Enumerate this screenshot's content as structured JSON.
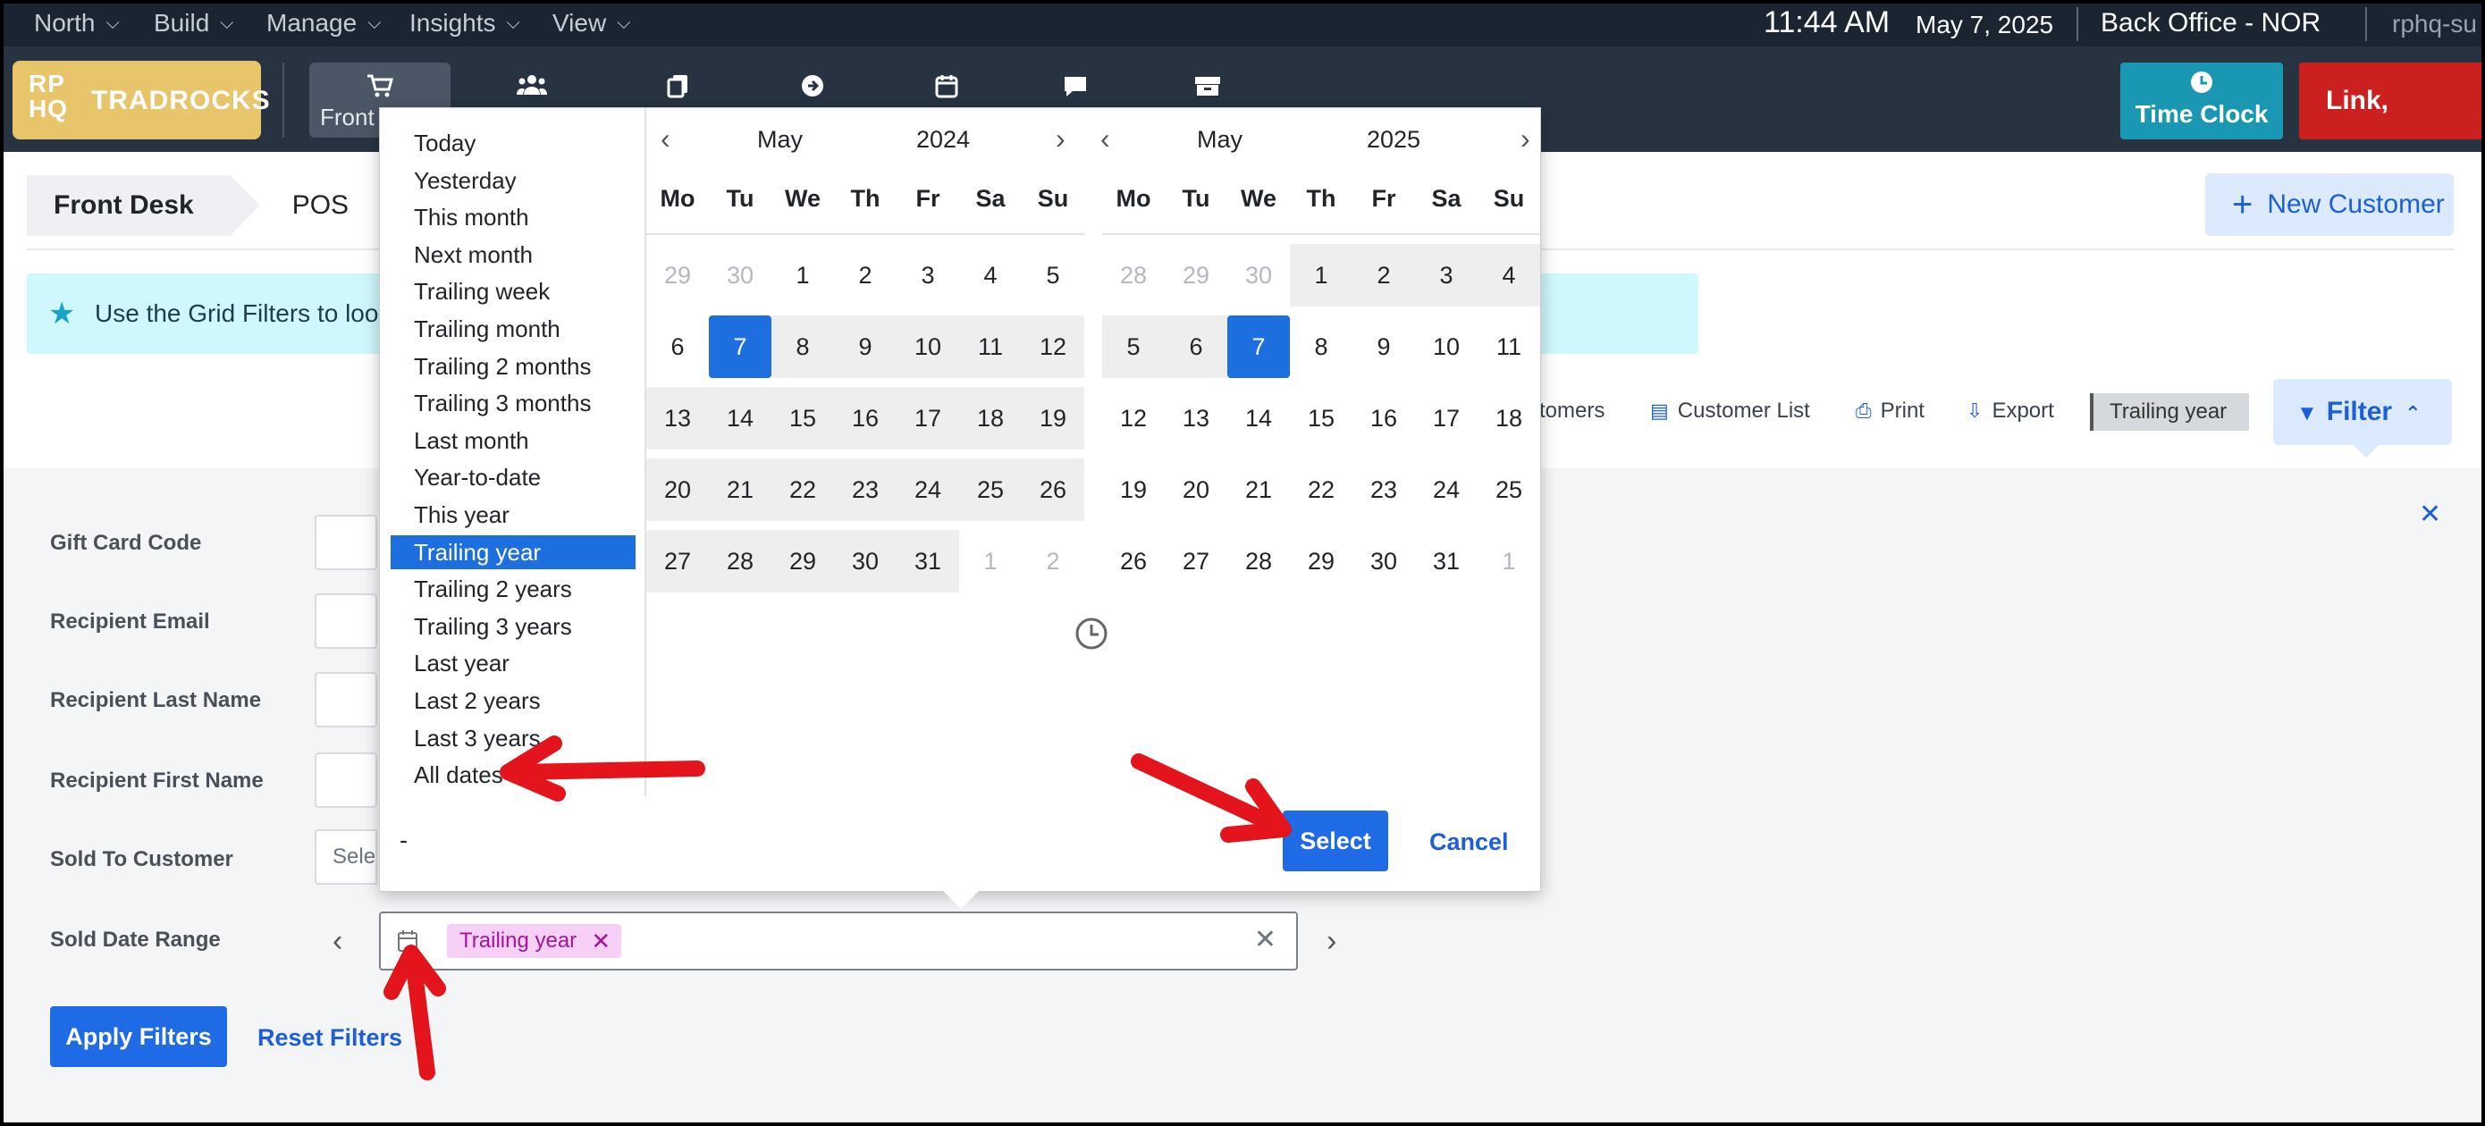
{
  "topnav": {
    "menus": [
      "North",
      "Build",
      "Manage",
      "Insights",
      "View"
    ],
    "time": "11:44 AM",
    "date": "May 7, 2025",
    "office": "Back Office - NOR",
    "user": "rphq-su"
  },
  "logo": {
    "mark_top": "RP",
    "mark_bottom": "HQ",
    "name": "TRADROCKS"
  },
  "iconbar": {
    "active_label": "Front",
    "icons": [
      "cart-icon",
      "users-icon",
      "documents-icon",
      "arrow-circle-icon",
      "calendar-icon",
      "chat-icon",
      "box-icon"
    ],
    "time_clock": "Time Clock",
    "staff_link": "Link, Carolyn"
  },
  "breadcrumbs": [
    "Front Desk",
    "POS"
  ],
  "new_customer": "New Customer",
  "banner": "Use the Grid Filters to look",
  "toolbar": {
    "customers": "tomers",
    "customer_list": "Customer List",
    "print": "Print",
    "export": "Export",
    "active_range": "Trailing year",
    "filter": "Filter"
  },
  "filters": {
    "labels": [
      "Gift Card Code",
      "Recipient Email",
      "Recipient Last Name",
      "Recipient First Name",
      "Sold To Customer",
      "Sold Date Range"
    ],
    "sold_to_placeholder": "Select",
    "date_tag": "Trailing year",
    "apply": "Apply Filters",
    "reset": "Reset Filters"
  },
  "picker": {
    "presets": [
      "Today",
      "Yesterday",
      "This month",
      "Next month",
      "Trailing week",
      "Trailing month",
      "Trailing 2 months",
      "Trailing 3 months",
      "Last month",
      "Year-to-date",
      "This year",
      "Trailing year",
      "Trailing 2 years",
      "Trailing 3 years",
      "Last year",
      "Last 2 years",
      "Last 3 years",
      "All dates"
    ],
    "selected_preset": "Trailing year",
    "weekdays": [
      "Mo",
      "Tu",
      "We",
      "Th",
      "Fr",
      "Sa",
      "Su"
    ],
    "left": {
      "month": "May",
      "year": "2024",
      "weeks": [
        [
          {
            "d": "29",
            "o": true
          },
          {
            "d": "30",
            "o": true
          },
          {
            "d": "1"
          },
          {
            "d": "2"
          },
          {
            "d": "3"
          },
          {
            "d": "4"
          },
          {
            "d": "5"
          }
        ],
        [
          {
            "d": "6"
          },
          {
            "d": "7",
            "s": true
          },
          {
            "d": "8",
            "r": true
          },
          {
            "d": "9",
            "r": true
          },
          {
            "d": "10",
            "r": true
          },
          {
            "d": "11",
            "r": true
          },
          {
            "d": "12",
            "r": true
          }
        ],
        [
          {
            "d": "13",
            "r": true
          },
          {
            "d": "14",
            "r": true
          },
          {
            "d": "15",
            "r": true
          },
          {
            "d": "16",
            "r": true
          },
          {
            "d": "17",
            "r": true
          },
          {
            "d": "18",
            "r": true
          },
          {
            "d": "19",
            "r": true
          }
        ],
        [
          {
            "d": "20",
            "r": true
          },
          {
            "d": "21",
            "r": true
          },
          {
            "d": "22",
            "r": true
          },
          {
            "d": "23",
            "r": true
          },
          {
            "d": "24",
            "r": true
          },
          {
            "d": "25",
            "r": true
          },
          {
            "d": "26",
            "r": true
          }
        ],
        [
          {
            "d": "27",
            "r": true
          },
          {
            "d": "28",
            "r": true
          },
          {
            "d": "29",
            "r": true
          },
          {
            "d": "30",
            "r": true
          },
          {
            "d": "31",
            "r": true
          },
          {
            "d": "1",
            "o": true
          },
          {
            "d": "2",
            "o": true
          }
        ]
      ]
    },
    "right": {
      "month": "May",
      "year": "2025",
      "weeks": [
        [
          {
            "d": "28",
            "o": true
          },
          {
            "d": "29",
            "o": true
          },
          {
            "d": "30",
            "o": true
          },
          {
            "d": "1",
            "r": true
          },
          {
            "d": "2",
            "r": true
          },
          {
            "d": "3",
            "r": true
          },
          {
            "d": "4",
            "r": true
          }
        ],
        [
          {
            "d": "5",
            "r": true
          },
          {
            "d": "6",
            "r": true
          },
          {
            "d": "7",
            "s": true
          },
          {
            "d": "8"
          },
          {
            "d": "9"
          },
          {
            "d": "10"
          },
          {
            "d": "11"
          }
        ],
        [
          {
            "d": "12"
          },
          {
            "d": "13"
          },
          {
            "d": "14"
          },
          {
            "d": "15"
          },
          {
            "d": "16"
          },
          {
            "d": "17"
          },
          {
            "d": "18"
          }
        ],
        [
          {
            "d": "19"
          },
          {
            "d": "20"
          },
          {
            "d": "21"
          },
          {
            "d": "22"
          },
          {
            "d": "23"
          },
          {
            "d": "24"
          },
          {
            "d": "25"
          }
        ],
        [
          {
            "d": "26"
          },
          {
            "d": "27"
          },
          {
            "d": "28"
          },
          {
            "d": "29"
          },
          {
            "d": "30"
          },
          {
            "d": "31"
          },
          {
            "d": "1",
            "o": true
          }
        ]
      ]
    },
    "range_text": "-",
    "select": "Select",
    "cancel": "Cancel"
  },
  "colors": {
    "accent": "#1d6fe0",
    "annotation_arrow": "#e3141b",
    "time_clock": "#1a97b3",
    "staff_link": "#cc1f1f",
    "logo": "#e8c46a"
  }
}
